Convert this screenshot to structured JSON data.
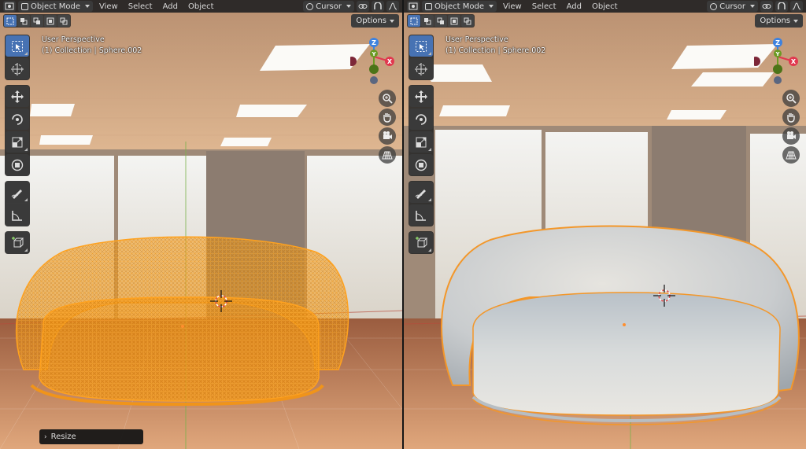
{
  "header": {
    "mode_label": "Object Mode",
    "menu": [
      "View",
      "Select",
      "Add",
      "Object"
    ],
    "pivot_label": "Cursor"
  },
  "options_label": "Options",
  "viewports": [
    {
      "name": "left",
      "overlay": {
        "title": "User Perspective",
        "subtitle": "(1) Collection | Sphere.002"
      },
      "shading": "wireframe"
    },
    {
      "name": "right",
      "overlay": {
        "title": "User Perspective",
        "subtitle": "(1) Collection | Sphere.002"
      },
      "shading": "rendered"
    }
  ],
  "gizmo": {
    "z": "Z",
    "x": "X",
    "y": "Y"
  },
  "redo_panel": {
    "label": "Resize"
  },
  "colors": {
    "accent": "#4772b3",
    "selection": "#ff9d1a",
    "x_axis": "#e1384f",
    "y_axis": "#6b9b22",
    "z_axis": "#3d82e0"
  },
  "icons": [
    "object-mode-icon",
    "editor-type-icon",
    "pivot-icon",
    "snap-icon",
    "proportional-icon",
    "zoom-icon",
    "hand-icon",
    "camera-icon",
    "grid-icon",
    "select-box-icon",
    "cursor-icon",
    "move-icon",
    "rotate-icon",
    "scale-icon",
    "transform-icon",
    "annotate-icon",
    "measure-icon",
    "add-cube-icon"
  ]
}
